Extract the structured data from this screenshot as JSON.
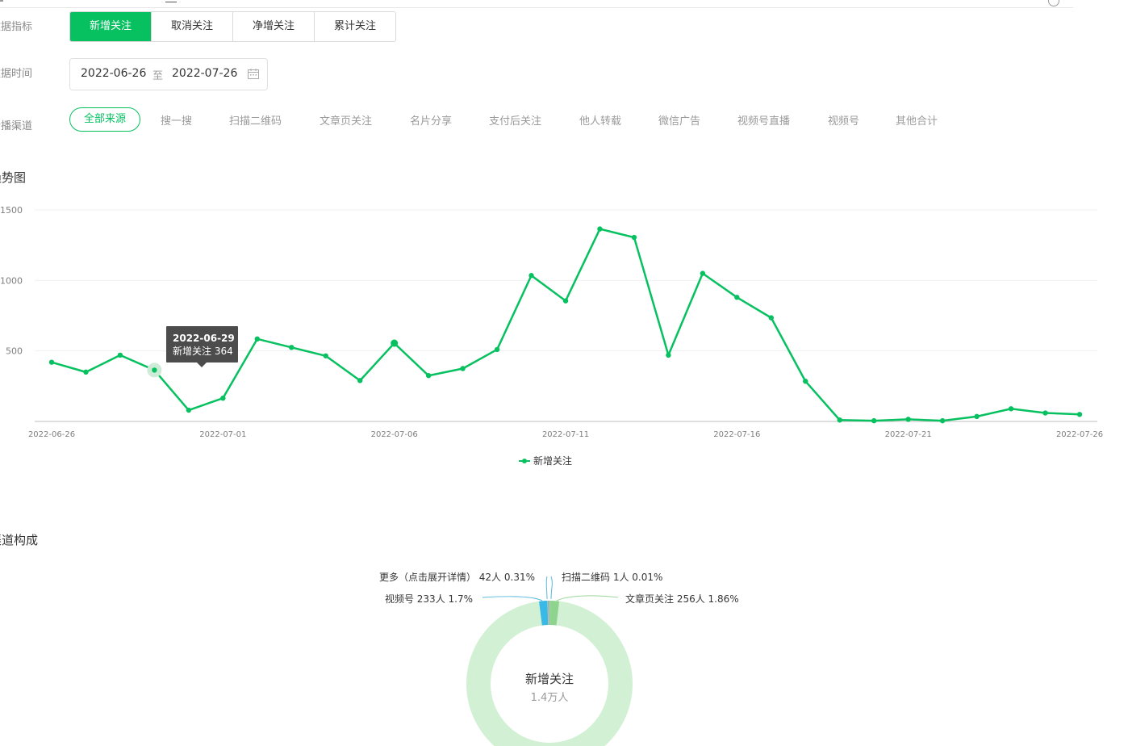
{
  "filters": {
    "metric": {
      "label": "数据指标",
      "options": [
        "新增关注",
        "取消关注",
        "净增关注",
        "累计关注"
      ],
      "active_index": 0
    },
    "time": {
      "label": "数据时间",
      "start": "2022-06-26",
      "separator": "至",
      "end": "2022-07-26"
    },
    "channel": {
      "label": "传播渠道",
      "options": [
        "全部来源",
        "搜一搜",
        "扫描二维码",
        "文章页关注",
        "名片分享",
        "支付后关注",
        "他人转载",
        "微信广告",
        "视频号直播",
        "视频号",
        "其他合计"
      ],
      "active_index": 0
    }
  },
  "colors": {
    "accent": "#07c160",
    "donut_main": "#d2f0d3",
    "video": "#38b9e6",
    "article": "#8fd48e",
    "more": "#aaaaaa"
  },
  "trend_title": "趋势图",
  "channel_title": "渠道构成",
  "chart_data": [
    {
      "type": "line",
      "x": [
        "2022-06-26",
        "2022-06-27",
        "2022-06-28",
        "2022-06-29",
        "2022-06-30",
        "2022-07-01",
        "2022-07-02",
        "2022-07-03",
        "2022-07-04",
        "2022-07-05",
        "2022-07-06",
        "2022-07-07",
        "2022-07-08",
        "2022-07-09",
        "2022-07-10",
        "2022-07-11",
        "2022-07-12",
        "2022-07-13",
        "2022-07-14",
        "2022-07-15",
        "2022-07-16",
        "2022-07-17",
        "2022-07-18",
        "2022-07-19",
        "2022-07-20",
        "2022-07-21",
        "2022-07-22",
        "2022-07-23",
        "2022-07-24",
        "2022-07-25",
        "2022-07-26"
      ],
      "xticks": [
        "2022-06-26",
        "2022-07-01",
        "2022-07-06",
        "2022-07-11",
        "2022-07-16",
        "2022-07-21",
        "2022-07-26"
      ],
      "yticks": [
        500,
        1000,
        1500
      ],
      "ylim": [
        0,
        1500
      ],
      "series": [
        {
          "name": "新增关注",
          "values": [
            420,
            350,
            470,
            364,
            80,
            165,
            585,
            525,
            465,
            290,
            555,
            325,
            375,
            510,
            1035,
            855,
            1365,
            1305,
            470,
            1050,
            880,
            735,
            285,
            10,
            5,
            15,
            5,
            35,
            90,
            60,
            50
          ]
        }
      ],
      "tooltip": {
        "index": 3,
        "date": "2022-06-29",
        "label": "新增关注",
        "value": "364"
      },
      "legend": "bottom-center",
      "grid": true
    },
    {
      "type": "pie",
      "center_label": "新增关注",
      "center_value": "1.4万人",
      "slices": [
        {
          "name": "扫描二维码",
          "count": "1人",
          "percent": 0.01
        },
        {
          "name": "文章页关注",
          "count": "256人",
          "percent": 1.86
        },
        {
          "name": "视频号",
          "count": "233人",
          "percent": 1.7
        },
        {
          "name": "更多（点击展开详情）",
          "count": "42人",
          "percent": 0.31
        }
      ]
    }
  ]
}
